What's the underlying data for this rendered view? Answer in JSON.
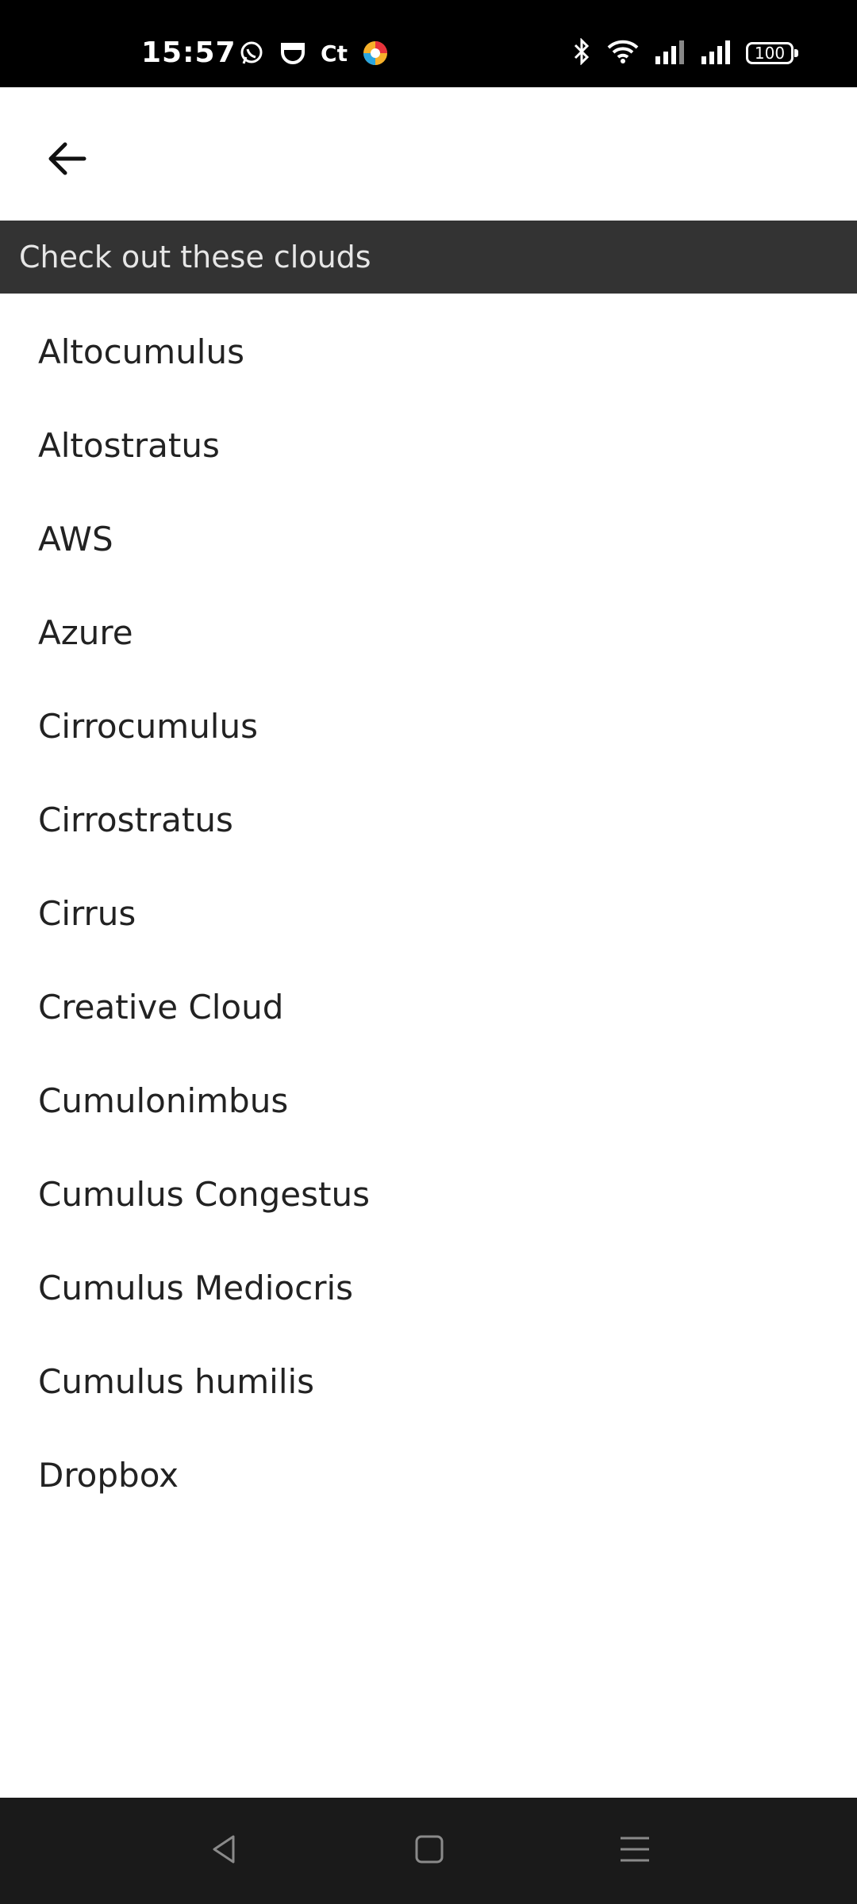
{
  "status_bar": {
    "time": "15:57",
    "battery": "100",
    "left_icons": [
      "whatsapp-icon",
      "shield-app-icon",
      "ct-app-icon",
      "colorful-app-icon"
    ],
    "right_icons": [
      "bluetooth-icon",
      "wifi-icon",
      "signal-icon",
      "signal-icon"
    ]
  },
  "app_bar": {
    "back_icon": "arrow-left-icon"
  },
  "section": {
    "title": "Check out these clouds"
  },
  "list": {
    "items": [
      "Altocumulus",
      "Altostratus",
      "AWS",
      "Azure",
      "Cirrocumulus",
      "Cirrostratus",
      "Cirrus",
      "Creative Cloud",
      "Cumulonimbus",
      "Cumulus Congestus",
      "Cumulus Mediocris",
      "Cumulus humilis",
      "Dropbox"
    ]
  },
  "nav_bar": {
    "buttons": [
      "back-nav-icon",
      "home-nav-icon",
      "menu-nav-icon"
    ]
  }
}
